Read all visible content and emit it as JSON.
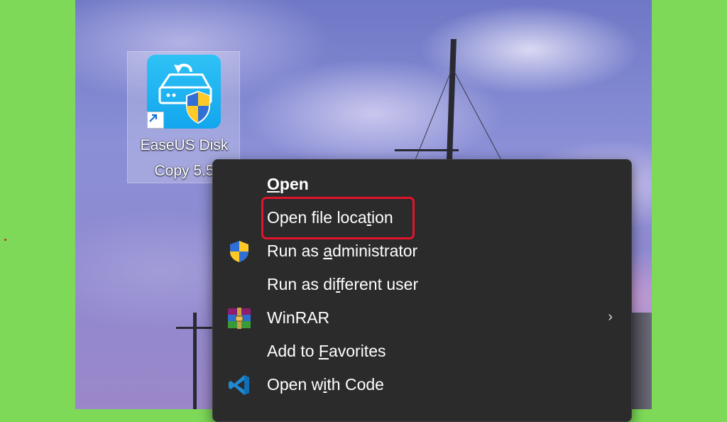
{
  "desktop": {
    "icon": {
      "label_line1": "EaseUS Disk",
      "label_line2": "Copy 5.5",
      "icon_name": "easeus-disk-copy-app-icon",
      "overlay_icon": "shortcut-arrow-icon"
    }
  },
  "context_menu": {
    "items": [
      {
        "pre": "",
        "u": "O",
        "post": "pen",
        "icon": "",
        "bold": true
      },
      {
        "pre": "Open file loca",
        "u": "t",
        "post": "ion",
        "icon": "",
        "highlighted": true
      },
      {
        "pre": "Run as ",
        "u": "a",
        "post": "dministrator",
        "icon": "uac-shield-icon"
      },
      {
        "pre": "Run as di",
        "u": "f",
        "post": "ferent user",
        "icon": ""
      },
      {
        "pre": "WinRAR",
        "u": "",
        "post": "",
        "icon": "winrar-icon",
        "submenu": true
      },
      {
        "pre": "Add to ",
        "u": "F",
        "post": "avorites",
        "icon": ""
      },
      {
        "pre": "Open w",
        "u": "i",
        "post": "th Code",
        "icon": "vscode-icon"
      }
    ]
  },
  "colors": {
    "page_background": "#7dd957",
    "menu_background": "#2b2b2b",
    "highlight_border": "#e2142d"
  }
}
